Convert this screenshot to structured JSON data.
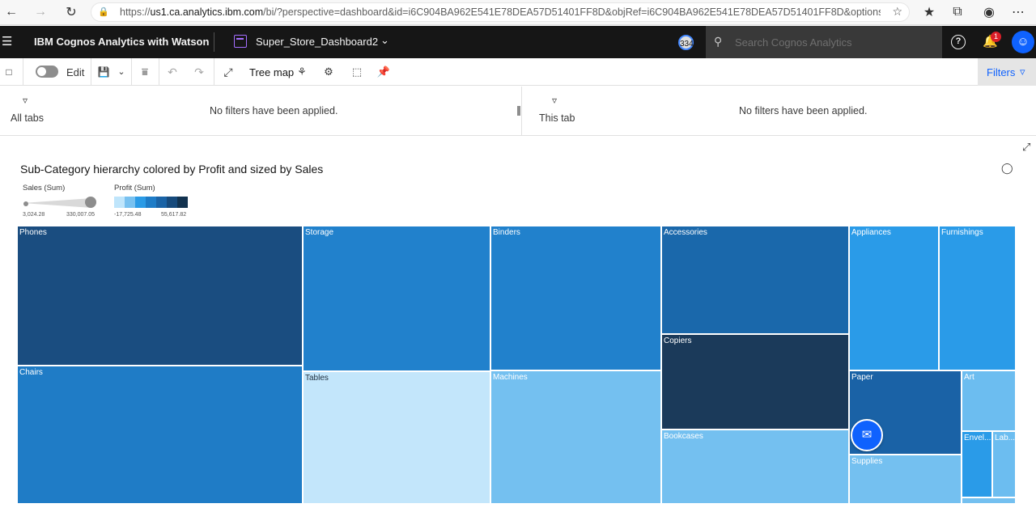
{
  "browser": {
    "url_prefix": "https://",
    "url_host": "us1.ca.analytics.ibm.com",
    "url_rest": "/bi/?perspective=dashboard&id=i6C904BA962E541E78DEA57D51401FF8D&objRef=i6C904BA962E541E78DEA57D51401FF8D&options%5Bdisable..."
  },
  "header": {
    "brand": "IBM Cognos Analytics with Watson",
    "dashboard_name": "Super_Store_Dashboard2",
    "count_badge": "334",
    "search_placeholder": "Search Cognos Analytics",
    "notification_count": "1"
  },
  "toolbar": {
    "edit_label": "Edit",
    "viz_type_label": "Tree map",
    "filters_label": "Filters"
  },
  "filters": {
    "all_tabs_label": "All tabs",
    "all_tabs_message": "No filters have been applied.",
    "this_tab_label": "This tab",
    "this_tab_message": "No filters have been applied."
  },
  "visualization": {
    "title": "Sub-Category hierarchy colored by Profit and sized by Sales",
    "size_legend": {
      "label": "Sales (Sum)",
      "min": "3,024.28",
      "max": "330,007.05"
    },
    "color_legend": {
      "label": "Profit (Sum)",
      "min": "-17,725.48",
      "max": "55,617.82",
      "swatches": [
        "#bfe5fb",
        "#78c1f0",
        "#2b9be6",
        "#1e7cc7",
        "#1a63a6",
        "#174a7c",
        "#12324f"
      ]
    }
  },
  "chart_data": {
    "type": "treemap",
    "title": "Sub-Category hierarchy colored by Profit and sized by Sales",
    "size_measure": "Sales (Sum)",
    "color_measure": "Profit (Sum)",
    "size_range": [
      3024.28,
      330007.05
    ],
    "color_range": [
      -17725.48,
      55617.82
    ],
    "items": [
      {
        "name": "Phones",
        "color": "#1a4d80"
      },
      {
        "name": "Chairs",
        "color": "#1f7cc6"
      },
      {
        "name": "Storage",
        "color": "#2181cc"
      },
      {
        "name": "Tables",
        "color": "#c3e6fb"
      },
      {
        "name": "Binders",
        "color": "#2181cc"
      },
      {
        "name": "Machines",
        "color": "#74c0f0"
      },
      {
        "name": "Accessories",
        "color": "#1a68ab"
      },
      {
        "name": "Copiers",
        "color": "#1b3a5a"
      },
      {
        "name": "Bookcases",
        "color": "#74c0f0"
      },
      {
        "name": "Appliances",
        "color": "#2a9be8"
      },
      {
        "name": "Furnishings",
        "color": "#2a9be8"
      },
      {
        "name": "Paper",
        "color": "#1a62a6"
      },
      {
        "name": "Art",
        "color": "#6cbdf0"
      },
      {
        "name": "Supplies",
        "color": "#74c0f0"
      },
      {
        "name": "Envel...",
        "color": "#2a9be8"
      },
      {
        "name": "Lab...",
        "color": "#6cbdf0"
      },
      {
        "name": "",
        "color": "#74c0f0"
      }
    ]
  }
}
